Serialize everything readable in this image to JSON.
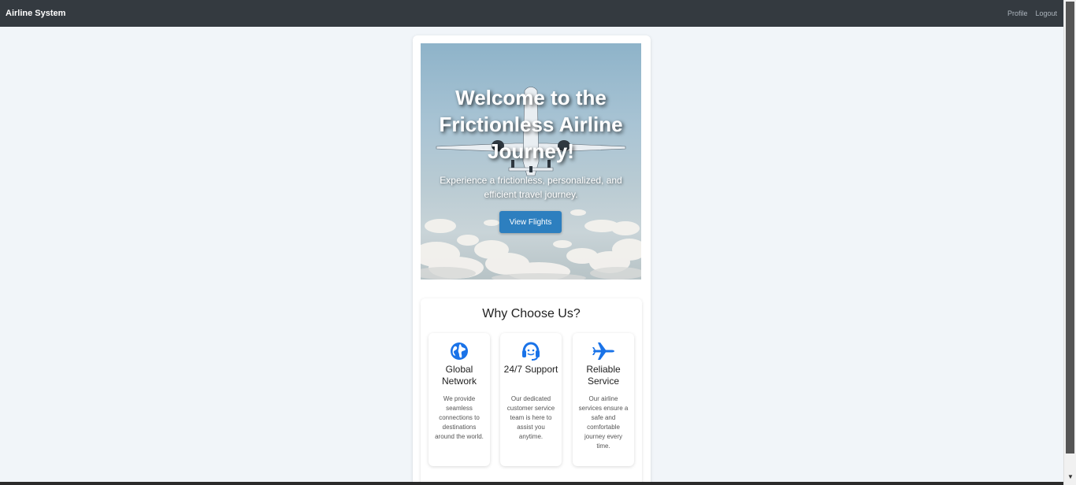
{
  "navbar": {
    "brand": "Airline System",
    "links": [
      "Profile",
      "Logout"
    ]
  },
  "hero": {
    "title": "Welcome to the Frictionless Airline Journey!",
    "subtitle": "Experience a frictionless, personalized, and efficient travel journey.",
    "button_label": "View Flights"
  },
  "why": {
    "title": "Why Choose Us?",
    "features": [
      {
        "icon": "globe-icon",
        "title": "Global Network",
        "description": "We provide seamless connections to destinations around the world."
      },
      {
        "icon": "headset-icon",
        "title": "24/7 Support",
        "description": "Our dedicated customer service team is here to assist you anytime."
      },
      {
        "icon": "plane-icon",
        "title": "Reliable Service",
        "description": "Our airline services ensure a safe and comfortable journey every time."
      }
    ]
  },
  "colors": {
    "navbar": "#343a40",
    "accent": "#2d7fbf",
    "icon": "#1a73e8",
    "background": "#f1f5f9"
  }
}
